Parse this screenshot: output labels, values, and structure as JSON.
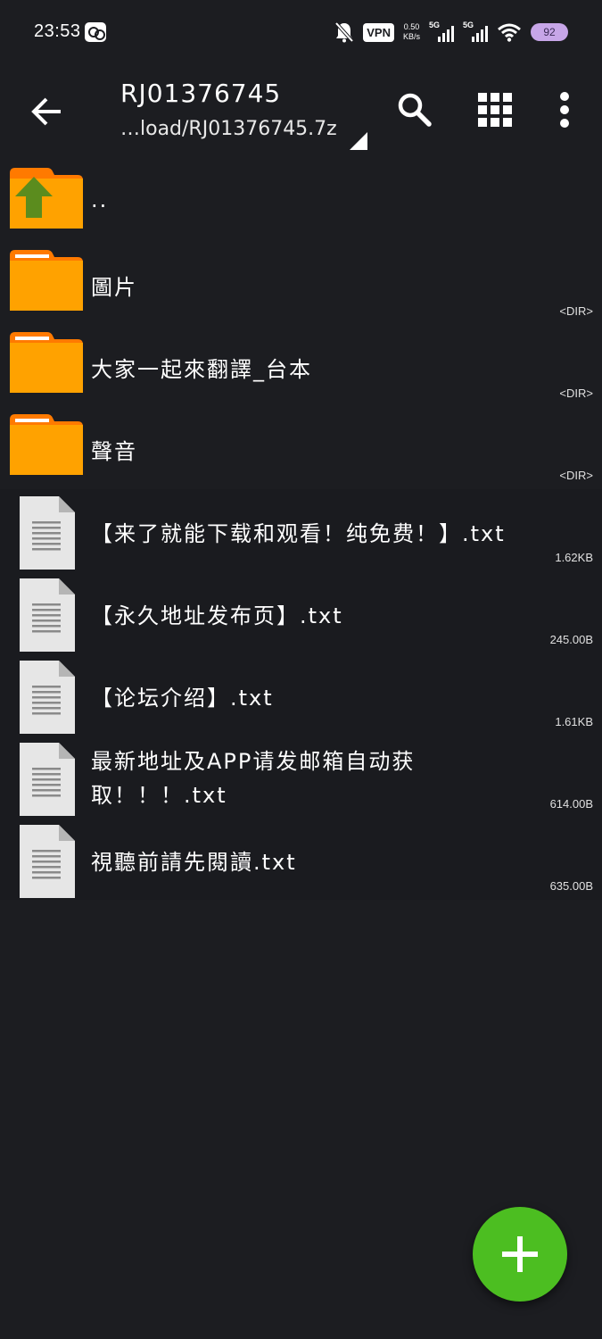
{
  "status_bar": {
    "time": "23:53",
    "vpn": "VPN",
    "speed_value": "0.50",
    "speed_unit": "KB/s",
    "network_1": "5G",
    "network_2": "5G",
    "battery": "92"
  },
  "toolbar": {
    "title": "RJ01376745",
    "subtitle": "…load/RJ01376745.7z"
  },
  "items": [
    {
      "name": "..",
      "meta": "",
      "kind": "parent"
    },
    {
      "name": "圖片",
      "meta": "<DIR>",
      "kind": "folder"
    },
    {
      "name": "大家一起來翻譯_台本",
      "meta": "<DIR>",
      "kind": "folder"
    },
    {
      "name": "聲音",
      "meta": "<DIR>",
      "kind": "folder"
    },
    {
      "name": "【来了就能下载和观看！纯免费！】.txt",
      "meta": "1.62KB",
      "kind": "file"
    },
    {
      "name": "【永久地址发布页】.txt",
      "meta": "245.00B",
      "kind": "file"
    },
    {
      "name": "【论坛介绍】.txt",
      "meta": "1.61KB",
      "kind": "file"
    },
    {
      "name": "最新地址及APP请发邮箱自动获取！！！.txt",
      "meta": "614.00B",
      "kind": "file"
    },
    {
      "name": "視聽前請先閱讀.txt",
      "meta": "635.00B",
      "kind": "file"
    }
  ],
  "colors": {
    "background": "#1c1d21",
    "folder": "#ffa200",
    "folder_tab": "#ff7a00",
    "fab": "#4cbe21",
    "up_arrow": "#5b8c1e"
  }
}
